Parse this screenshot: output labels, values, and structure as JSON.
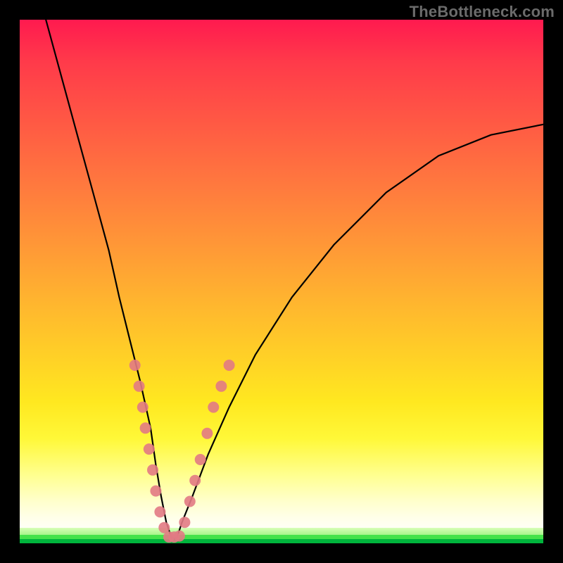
{
  "attribution": "TheBottleneck.com",
  "colors": {
    "dot": "#e27a84",
    "curve": "#000000",
    "gradient_top": "#ff1a4f",
    "gradient_bottom_green": "#00b43c"
  },
  "chart_data": {
    "type": "line",
    "title": "",
    "xlabel": "",
    "ylabel": "",
    "xlim": [
      0,
      100
    ],
    "ylim": [
      0,
      100
    ],
    "note": "Values are approximate, read off the unlabeled plot by position as percent of plot width/height (0,0 = bottom-left). The curve is a V-shaped bottleneck curve; salmon dots mark sampled points along the two arms near the trough.",
    "series": [
      {
        "name": "bottleneck-curve",
        "x": [
          5,
          8,
          11,
          14,
          17,
          19,
          21,
          23,
          25,
          26,
          27,
          28,
          29,
          30,
          31,
          33,
          36,
          40,
          45,
          52,
          60,
          70,
          80,
          90,
          100
        ],
        "y": [
          100,
          89,
          78,
          67,
          56,
          47,
          39,
          31,
          22,
          15,
          9,
          4,
          1,
          1,
          4,
          9,
          17,
          26,
          36,
          47,
          57,
          67,
          74,
          78,
          80
        ]
      }
    ],
    "dots": {
      "name": "sample-points",
      "points": [
        {
          "x": 22.0,
          "y": 34
        },
        {
          "x": 22.8,
          "y": 30
        },
        {
          "x": 23.5,
          "y": 26
        },
        {
          "x": 24.0,
          "y": 22
        },
        {
          "x": 24.7,
          "y": 18
        },
        {
          "x": 25.4,
          "y": 14
        },
        {
          "x": 26.0,
          "y": 10
        },
        {
          "x": 26.8,
          "y": 6
        },
        {
          "x": 27.6,
          "y": 3
        },
        {
          "x": 28.5,
          "y": 1.2
        },
        {
          "x": 29.5,
          "y": 1.2
        },
        {
          "x": 30.5,
          "y": 1.4
        },
        {
          "x": 31.5,
          "y": 4
        },
        {
          "x": 32.5,
          "y": 8
        },
        {
          "x": 33.5,
          "y": 12
        },
        {
          "x": 34.5,
          "y": 16
        },
        {
          "x": 35.8,
          "y": 21
        },
        {
          "x": 37.0,
          "y": 26
        },
        {
          "x": 38.5,
          "y": 30
        },
        {
          "x": 40.0,
          "y": 34
        }
      ]
    }
  }
}
